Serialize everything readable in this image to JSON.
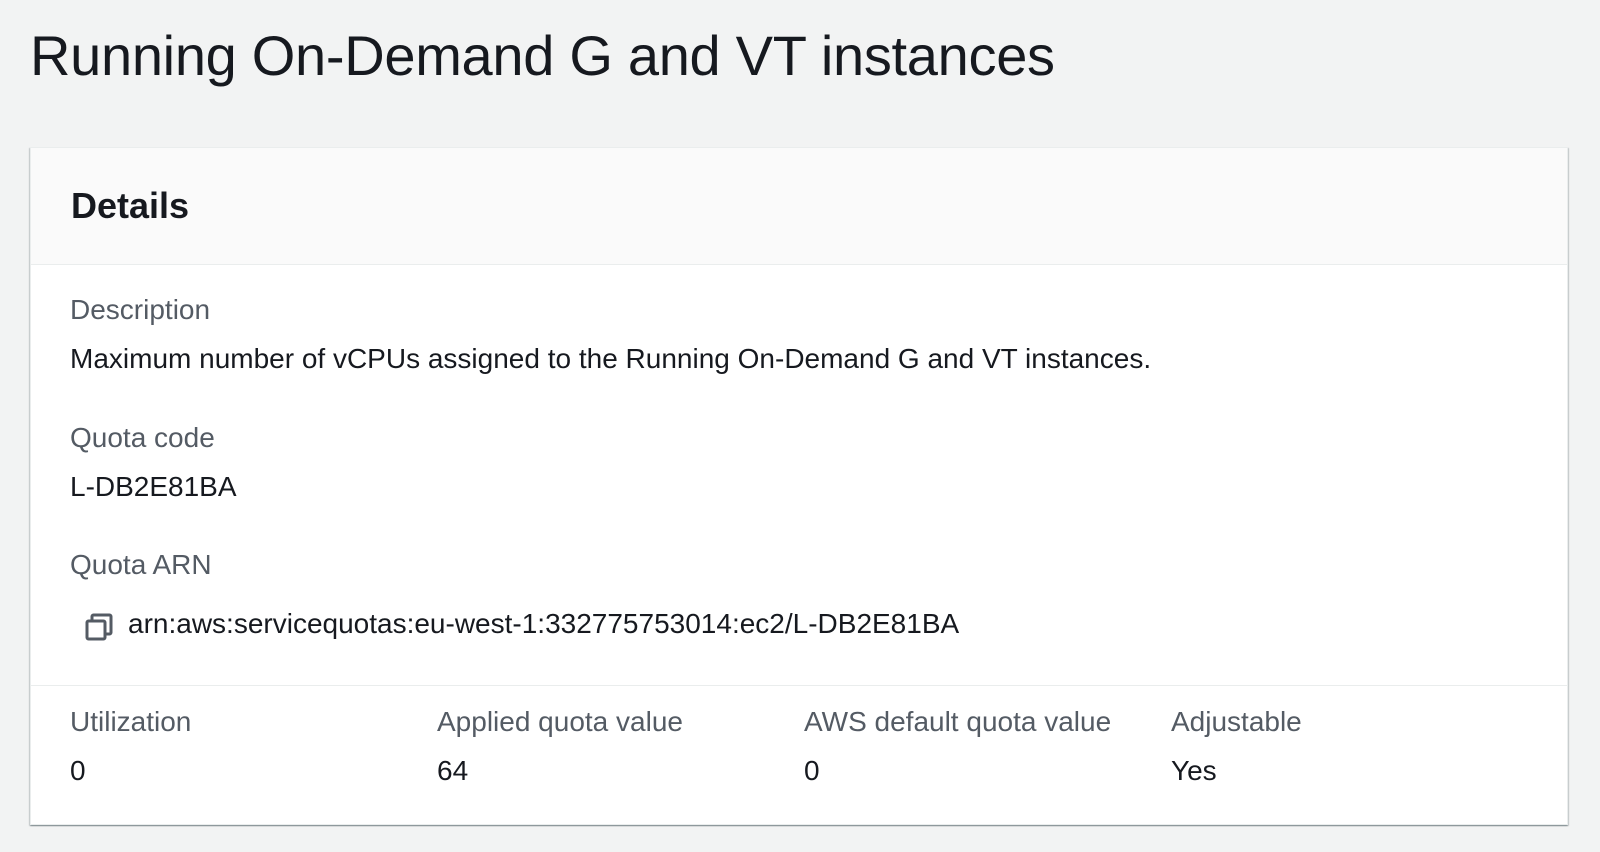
{
  "page": {
    "title": "Running On-Demand G and VT instances"
  },
  "details": {
    "header": "Details",
    "description": {
      "label": "Description",
      "value": "Maximum number of vCPUs assigned to the Running On-Demand G and VT instances."
    },
    "quota_code": {
      "label": "Quota code",
      "value": "L-DB2E81BA"
    },
    "quota_arn": {
      "label": "Quota ARN",
      "value": "arn:aws:servicequotas:eu-west-1:332775753014:ec2/L-DB2E81BA",
      "copy_icon": "copy-icon"
    },
    "stats": [
      {
        "label": "Utilization",
        "value": "0"
      },
      {
        "label": "Applied quota value",
        "value": "64"
      },
      {
        "label": "AWS default quota value",
        "value": "0"
      },
      {
        "label": "Adjustable",
        "value": "Yes"
      }
    ]
  },
  "colors": {
    "background": "#f2f3f3",
    "panel": "#ffffff",
    "label": "#545b64",
    "text": "#16191f"
  }
}
